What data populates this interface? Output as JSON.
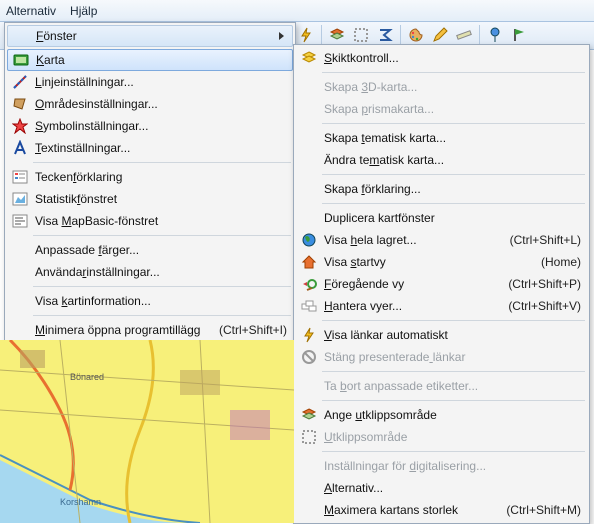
{
  "menubar": {
    "alternativ": "Alternativ",
    "hjalp": "Hjälp"
  },
  "left_menu": {
    "header": "Fönster",
    "items": [
      {
        "label": "Karta",
        "icon": "map-icon",
        "selected": true
      },
      {
        "label": "Linjeinställningar...",
        "icon": "line-icon"
      },
      {
        "label": "Områdesinställningar...",
        "icon": "region-icon"
      },
      {
        "label": "Symbolinställningar...",
        "icon": "symbol-icon"
      },
      {
        "label": "Textinställningar...",
        "icon": "text-icon"
      },
      {
        "sep": true
      },
      {
        "label": "Teckenförklaring",
        "icon": "legend-icon"
      },
      {
        "label": "Statistikfönstret",
        "icon": "stats-icon"
      },
      {
        "label": "Visa MapBasic-fönstret",
        "icon": "mapbasic-icon"
      },
      {
        "sep": true
      },
      {
        "label": "Anpassade färger..."
      },
      {
        "label": "Användarinställningar..."
      },
      {
        "sep": true
      },
      {
        "label": "Visa kartinformation..."
      },
      {
        "sep": true
      },
      {
        "label": "Minimera öppna programtillägg",
        "shortcut": "(Ctrl+Shift+I)"
      }
    ]
  },
  "right_menu": {
    "items": [
      {
        "label": "Skiktkontroll...",
        "icon": "layers-icon"
      },
      {
        "sep": true
      },
      {
        "label": "Skapa 3D-karta...",
        "disabled": true
      },
      {
        "label": "Skapa prismakarta...",
        "disabled": true
      },
      {
        "sep": true
      },
      {
        "label": "Skapa tematisk karta..."
      },
      {
        "label": "Ändra tematisk karta..."
      },
      {
        "sep": true
      },
      {
        "label": "Skapa förklaring..."
      },
      {
        "sep": true
      },
      {
        "label": "Duplicera kartfönster"
      },
      {
        "label": "Visa hela lagret...",
        "icon": "globe-icon",
        "shortcut": "(Ctrl+Shift+L)"
      },
      {
        "label": "Visa startvy",
        "icon": "house-icon",
        "shortcut": "(Home)"
      },
      {
        "label": "Föregående vy",
        "icon": "prev-icon",
        "shortcut": "(Ctrl+Shift+P)"
      },
      {
        "label": "Hantera vyer...",
        "icon": "views-icon",
        "shortcut": "(Ctrl+Shift+V)"
      },
      {
        "sep": true
      },
      {
        "label": "Visa länkar automatiskt",
        "icon": "bolt-icon"
      },
      {
        "label": "Stäng presenterade länkar",
        "icon": "close-links-icon",
        "disabled": true
      },
      {
        "sep": true
      },
      {
        "label": "Ta bort anpassade etiketter...",
        "disabled": true
      },
      {
        "sep": true
      },
      {
        "label": "Ange utklippsområde",
        "icon": "crop-set-icon"
      },
      {
        "label": "Utklippsområde",
        "icon": "crop-icon",
        "disabled": true
      },
      {
        "sep": true
      },
      {
        "label": "Inställningar för digitalisering...",
        "disabled": true
      },
      {
        "label": "Alternativ..."
      },
      {
        "label": "Maximera kartans storlek",
        "shortcut": "(Ctrl+Shift+M)"
      }
    ]
  },
  "toolbar": [
    "bolt-icon",
    "sep",
    "crop-set-icon",
    "crop-icon",
    "sigma-icon",
    "sep",
    "palette-icon",
    "pencil-icon",
    "ruler-icon",
    "sep",
    "pin-icon",
    "flag-icon"
  ],
  "underlines": {
    "Fönster": [
      0
    ],
    "Karta": [
      0
    ],
    "Linjeinställningar...": [
      0
    ],
    "Områdesinställningar...": [
      0
    ],
    "Symbolinställningar...": [
      0
    ],
    "Textinställningar...": [
      0
    ],
    "Teckenförklaring": [
      6
    ],
    "Statistikfönstret": [
      9
    ],
    "Visa MapBasic-fönstret": [
      5
    ],
    "Anpassade färger...": [
      10
    ],
    "Användarinställningar...": [
      7
    ],
    "Visa kartinformation...": [
      5
    ],
    "Minimera öppna programtillägg": [
      0
    ],
    "Skiktkontroll...": [
      0
    ],
    "Skapa 3D-karta...": [
      6
    ],
    "Skapa prismakarta...": [
      6
    ],
    "Skapa tematisk karta...": [
      6
    ],
    "Ändra tematisk karta...": [
      8
    ],
    "Skapa förklaring...": [
      6
    ],
    "Visa hela lagret...": [
      5
    ],
    "Visa startvy": [
      5
    ],
    "Föregående vy": [
      0
    ],
    "Hantera vyer...": [
      0
    ],
    "Visa länkar automatiskt": [
      0
    ],
    "Stäng presenterade länkar": [
      18
    ],
    "Ta bort anpassade etiketter...": [
      3
    ],
    "Ange utklippsområde": [
      5
    ],
    "Utklippsområde": [
      0
    ],
    "Inställningar för digitalisering...": [
      18
    ],
    "Alternativ...": [
      0
    ],
    "Maximera kartans storlek": [
      0
    ]
  }
}
